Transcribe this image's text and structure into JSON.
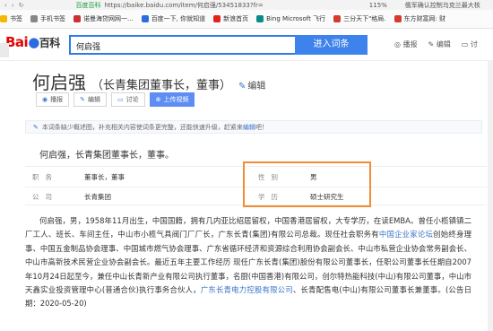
{
  "browser": {
    "nav_back": "‹",
    "nav_forward": "›",
    "nav_reload": "↻",
    "site_label": "百度百科",
    "url": "https://baike.baidu.com/item/何启强/53451833?fr=",
    "zoom": "115%",
    "news": "俄军确认控制乌克兰最大核",
    "bookmarks": [
      {
        "label": "书签",
        "color": "#f5b800"
      },
      {
        "label": "手机书签",
        "color": "#888888"
      },
      {
        "label": "诺曼海贷网网一...",
        "color": "#c83232"
      },
      {
        "label": "百度一下, 你就知道",
        "color": "#2d6be0"
      },
      {
        "label": "新浪首页",
        "color": "#e1251b"
      },
      {
        "label": "Bing Microsoft 飞行",
        "color": "#0a8a8a"
      },
      {
        "label": "三分天下\"格局.",
        "color": "#d63b2f"
      },
      {
        "label": "东方财富网: 财",
        "color": "#d63b2f"
      }
    ]
  },
  "header": {
    "logo_bai": "Bai",
    "logo_paw": "du",
    "logo_baike": "百科",
    "search_value": "何启强",
    "search_button": "进入词条",
    "links": [
      "播报",
      "编辑",
      "讨"
    ]
  },
  "entry": {
    "title": "何启强",
    "subtitle": "（长青集团董事长，董事）",
    "edit_label": "编辑",
    "actions": {
      "broadcast": "播报",
      "edit": "编辑",
      "discuss": "讨论",
      "upload": "上传视频"
    },
    "notice_text": "本词条缺少概述图，补充相关内容使词条更完整，还能快速升级，赶紧来",
    "notice_link": "编辑",
    "notice_end": "吧！",
    "summary": "何启强，长青集团董事长，董事。",
    "basic_info": {
      "position_key": "职务",
      "position_value": "董事长，董事",
      "company_key": "公司",
      "company_value": "长青集团",
      "gender_key": "性别",
      "gender_value": "男",
      "education_key": "学历",
      "education_value": "硕士研究生"
    },
    "paragraph": {
      "part1": "何启强，男，1958年11月出生，中国国籍，拥有几内亚比绍居留权，中国香港居留权，大专学历，在读EMBA。曾任小榄镇镇二厂工人、班长、车间主任，中山市小榄气具阀门厂厂长，广东长青(集团)有限公司总裁。现任社会职务有",
      "link1": "中国企业家论坛",
      "part2": "创始终身理事、中国五金制品协会理事、中国城市燃气协会理事、广东省循环经济和资源综合利用协会副会长、中山市私营企业协会常务副会长、中山市高新技术民营企业协会副会长。最近五年主要工作经历 现任广东长青(集团)股份有限公司董事长，任职公司董事长任期自2007年10月24日起至今，兼任中山长青新产业有限公司执行董事，名厨(中国香港)有限公司，创尔特热能科技(中山)有限公司董事，中山市天鑫实业投资管理中心(普通合伙)执行事务合伙人，",
      "link2": "广东长青电力控股有限公司",
      "part3": "、长青配售电(中山)有限公司董事长兼董事。(公告日期：2020-05-20)"
    }
  }
}
